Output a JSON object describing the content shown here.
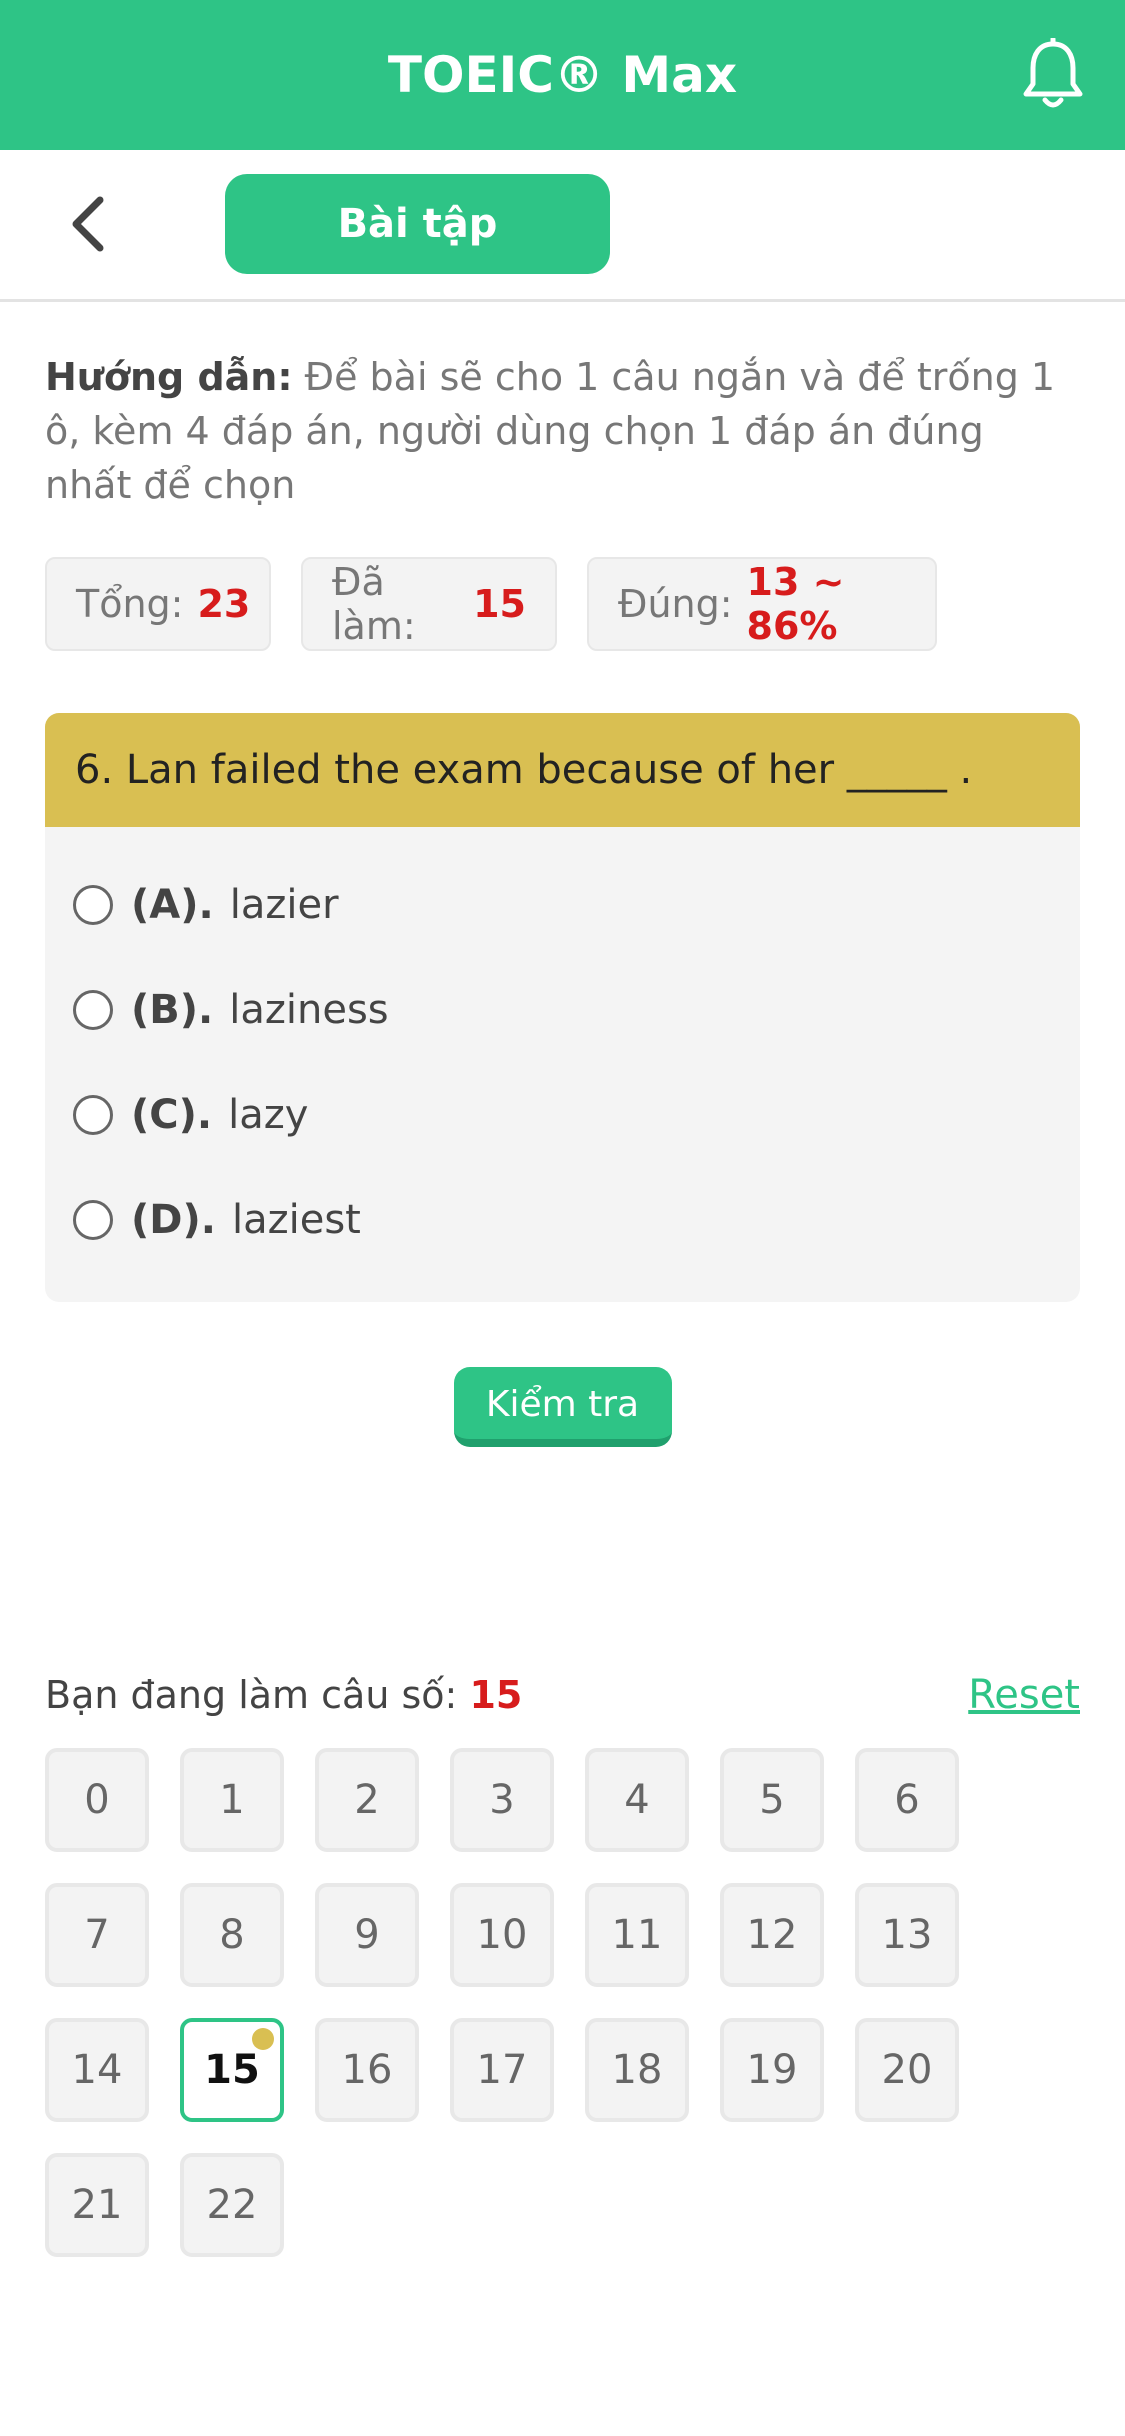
{
  "header": {
    "title": "TOEIC® Max"
  },
  "subheader": {
    "section_label": "Bài tập"
  },
  "instructions": {
    "label": "Hướng dẫn:",
    "text": "Để bài sẽ cho 1 câu ngắn và để trống 1 ô, kèm 4 đáp án, người dùng chọn 1 đáp án đúng nhất để chọn"
  },
  "stats": {
    "total_label": "Tổng:",
    "total_value": "23",
    "done_label": "Đã làm:",
    "done_value": "15",
    "correct_label": "Đúng:",
    "correct_value": "13 ~ 86%"
  },
  "question": {
    "text": "6. Lan failed the exam because of her _____ .",
    "options": [
      {
        "key": "(A).",
        "text": "lazier"
      },
      {
        "key": "(B).",
        "text": "laziness"
      },
      {
        "key": "(C).",
        "text": "lazy"
      },
      {
        "key": "(D).",
        "text": "laziest"
      }
    ]
  },
  "check_button": "Kiểm tra",
  "progress": {
    "label": "Bạn đang làm câu số:",
    "current": "15",
    "reset": "Reset"
  },
  "grid": [
    "0",
    "1",
    "2",
    "3",
    "4",
    "5",
    "6",
    "7",
    "8",
    "9",
    "10",
    "11",
    "12",
    "13",
    "14",
    "15",
    "16",
    "17",
    "18",
    "19",
    "20",
    "21",
    "22"
  ],
  "colors": {
    "primary": "#2ec486",
    "accent": "#d9bf52",
    "highlight": "#d71c1c"
  }
}
